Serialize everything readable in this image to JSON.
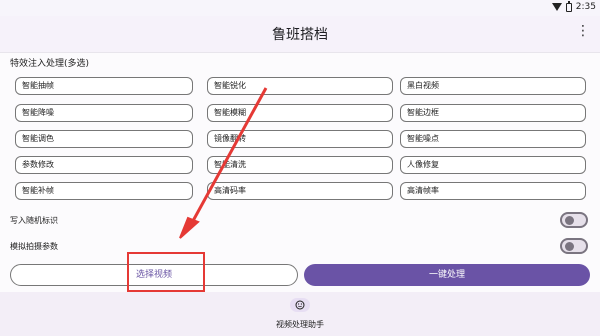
{
  "status": {
    "left": "",
    "time": "2:35"
  },
  "appbar": {
    "title": "鲁班搭档",
    "more_icon": "more-vertical-icon"
  },
  "section": {
    "title": "特效注入处理(多选)"
  },
  "options": [
    [
      "智能抽帧",
      "智能锐化",
      "黑白视频"
    ],
    [
      "智能降噪",
      "智能模糊",
      "智能边框"
    ],
    [
      "智能调色",
      "镜像翻转",
      "智能噪点"
    ],
    [
      "参数修改",
      "智能清洗",
      "人像修复"
    ],
    [
      "智能补帧",
      "高清码率",
      "高清帧率"
    ]
  ],
  "switches": [
    {
      "label": "写入随机标识",
      "on": false
    },
    {
      "label": "模拟拍摄参数",
      "on": false
    }
  ],
  "buttons": {
    "select": "选择视频",
    "process": "一键处理"
  },
  "nav": {
    "label": "视频处理助手",
    "icon": "smiley-icon"
  },
  "colors": {
    "accent": "#6a53a6",
    "annotation": "#e53935"
  }
}
